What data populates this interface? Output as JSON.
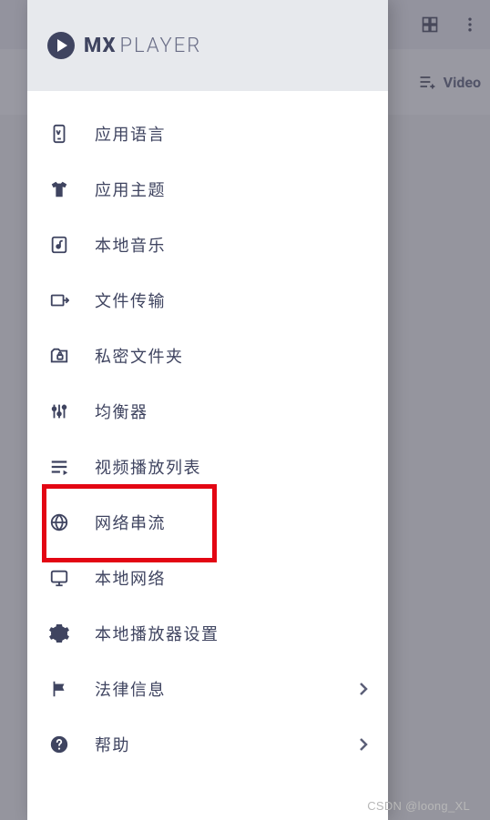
{
  "logo": {
    "brand_bold": "MX",
    "brand_light": "PLAYER"
  },
  "bg": {
    "video_label": "Video "
  },
  "nav": {
    "items": [
      {
        "key": "app-language",
        "label": "应用语言",
        "chevron": false
      },
      {
        "key": "app-theme",
        "label": "应用主题",
        "chevron": false
      },
      {
        "key": "local-music",
        "label": "本地音乐",
        "chevron": false
      },
      {
        "key": "file-transfer",
        "label": "文件传输",
        "chevron": false
      },
      {
        "key": "private-folder",
        "label": "私密文件夹",
        "chevron": false
      },
      {
        "key": "equalizer",
        "label": "均衡器",
        "chevron": false
      },
      {
        "key": "video-playlist",
        "label": "视频播放列表",
        "chevron": false
      },
      {
        "key": "network-stream",
        "label": "网络串流",
        "chevron": false
      },
      {
        "key": "local-network",
        "label": "本地网络",
        "chevron": false
      },
      {
        "key": "player-settings",
        "label": "本地播放器设置",
        "chevron": false
      },
      {
        "key": "legal",
        "label": "法律信息",
        "chevron": true
      },
      {
        "key": "help",
        "label": "帮助",
        "chevron": true
      }
    ]
  },
  "watermark": "CSDN @loong_XL"
}
